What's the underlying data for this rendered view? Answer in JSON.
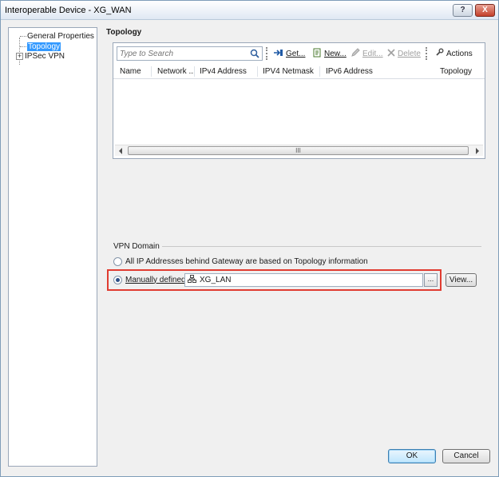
{
  "window": {
    "title": "Interoperable Device - XG_WAN",
    "help_label": "?",
    "close_label": "X"
  },
  "tree": {
    "items": [
      {
        "label": "General Properties"
      },
      {
        "label": "Topology"
      },
      {
        "label": "IPSec VPN"
      }
    ],
    "expander": "+"
  },
  "topology": {
    "title": "Topology",
    "search_placeholder": "Type to Search",
    "toolbar": {
      "get": "Get...",
      "new": "New...",
      "edit": "Edit...",
      "delete": "Delete",
      "actions": "Actions"
    },
    "columns": [
      "Name",
      "Network ...",
      "IPv4 Address",
      "IPV4 Netmask",
      "IPv6 Address",
      "Topology"
    ],
    "scroll_thumb": "III"
  },
  "vpn_domain": {
    "label": "VPN Domain",
    "option_all": "All IP Addresses behind Gateway are based on Topology information",
    "option_manual": "Manually defined",
    "selected": "manual",
    "object_value": "XG_LAN",
    "browse_label": "...",
    "view_label": "View..."
  },
  "buttons": {
    "ok": "OK",
    "cancel": "Cancel"
  },
  "colors": {
    "highlight": "#e03c31",
    "selection": "#3399ff"
  }
}
